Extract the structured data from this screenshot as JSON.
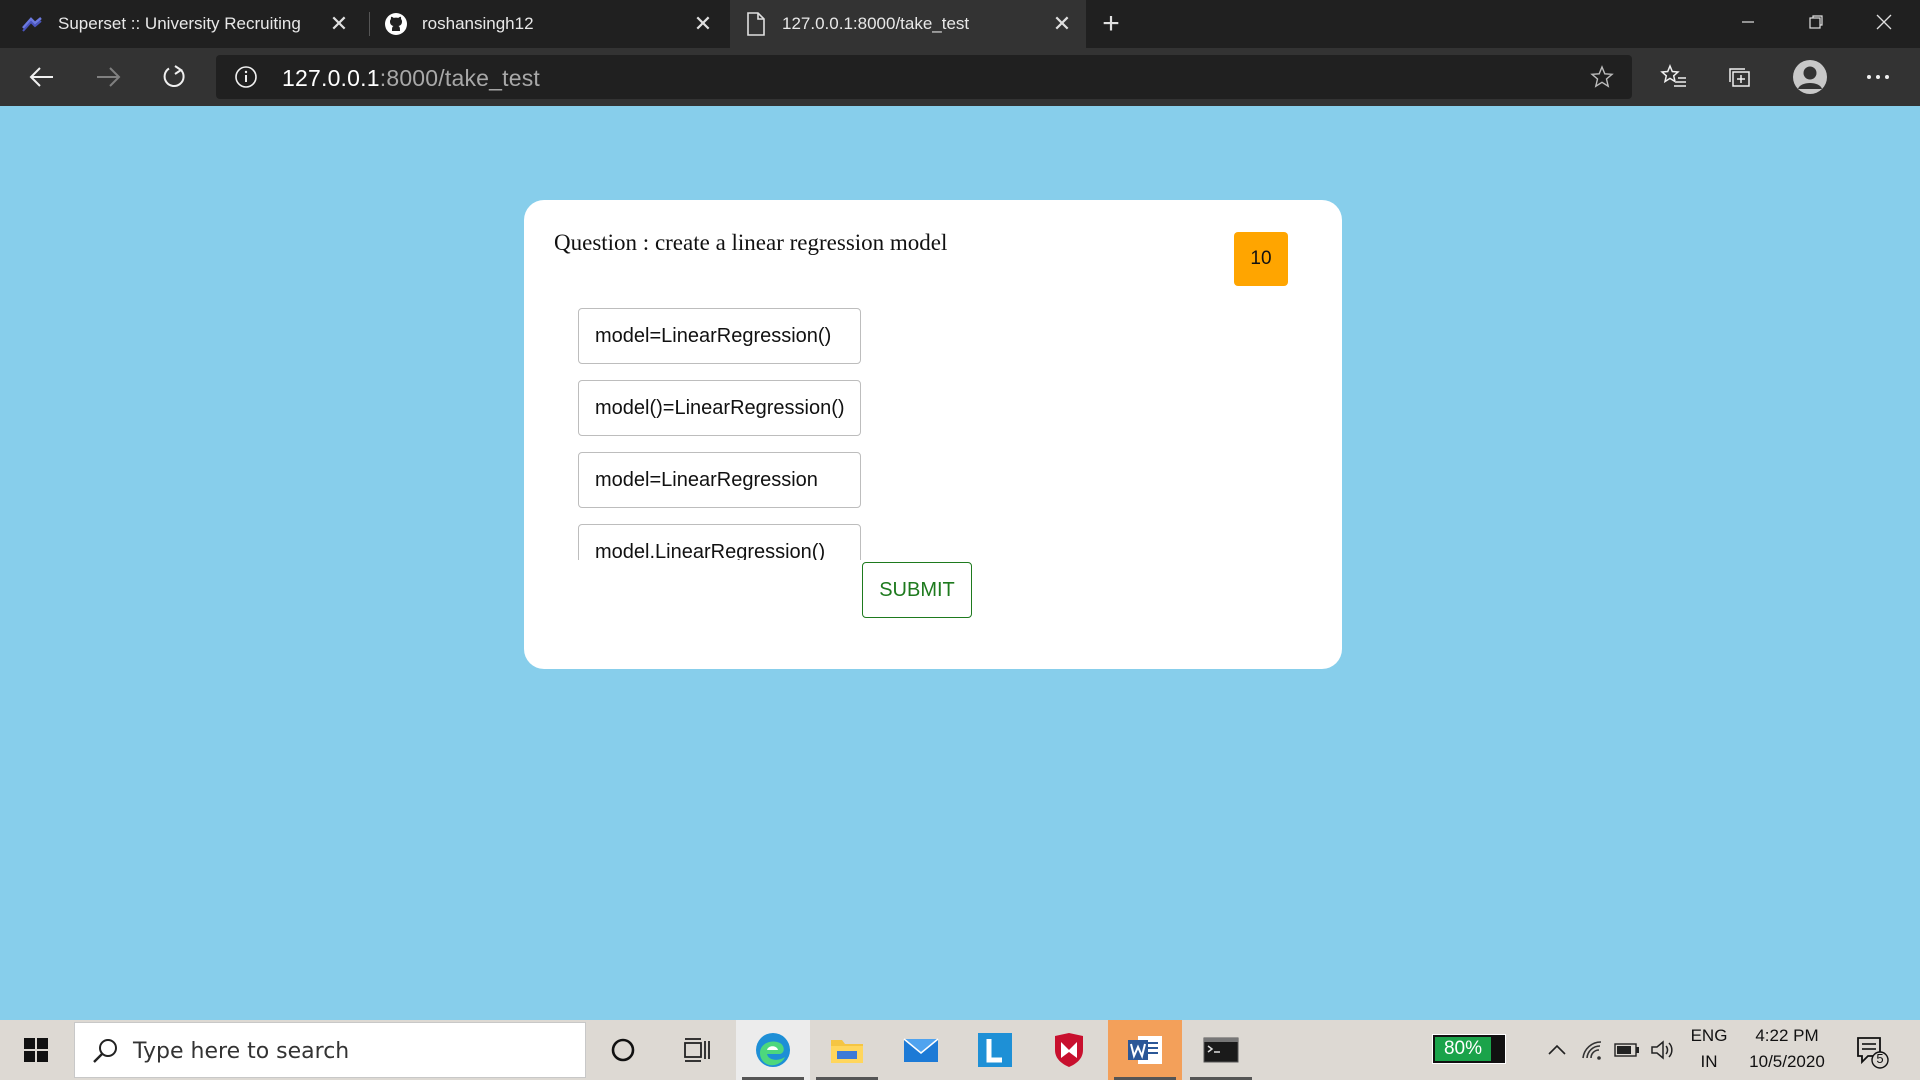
{
  "browser": {
    "tabs": [
      {
        "title": "Superset :: University Recruiting",
        "icon": "superset-icon"
      },
      {
        "title": "roshansingh12",
        "icon": "github-icon"
      },
      {
        "title": "127.0.0.1:8000/take_test",
        "icon": "page-icon",
        "active": true
      }
    ],
    "address": {
      "host": "127.0.0.1",
      "rest": ":8000/take_test"
    }
  },
  "quiz": {
    "question": "Question : create a linear regression model",
    "timer": "10",
    "options": [
      "model=LinearRegression()",
      "model()=LinearRegression()",
      "model=LinearRegression",
      "model.LinearRegression()"
    ],
    "submit_label": "SUBMIT"
  },
  "taskbar": {
    "search_placeholder": "Type here to search",
    "battery": "80%",
    "lang_top": "ENG",
    "lang_bottom": "IN",
    "time": "4:22 PM",
    "date": "10/5/2020",
    "notifications": "5"
  },
  "colors": {
    "page_bg": "#87ceeb",
    "timer_bg": "#ffa500",
    "submit_color": "#1e7a1e"
  }
}
